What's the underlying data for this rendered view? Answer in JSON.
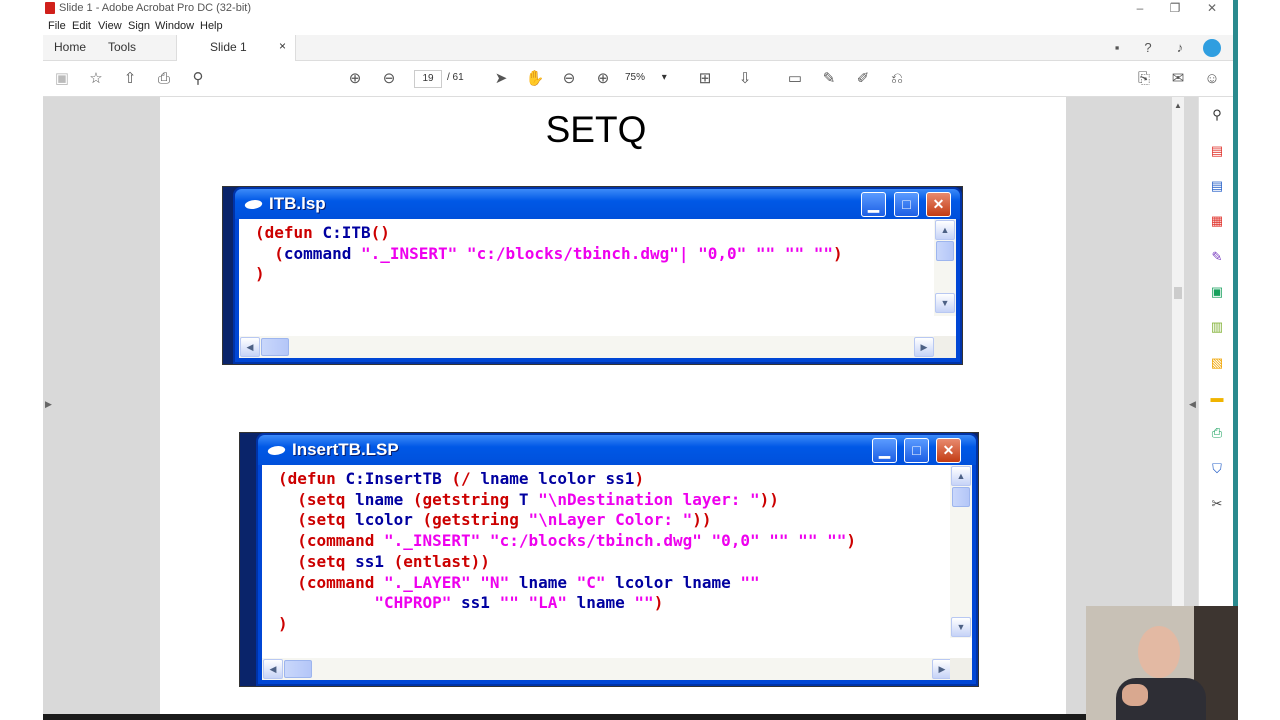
{
  "window": {
    "title": "Slide 1 - Adobe Acrobat Pro DC (32-bit)"
  },
  "menu": [
    "File",
    "Edit",
    "View",
    "Sign",
    "Window",
    "Help"
  ],
  "tabs": {
    "home": "Home",
    "tools": "Tools",
    "document": "Slide 1",
    "close": "×"
  },
  "toolbar": {
    "page_current": "19",
    "page_total": "/ 61",
    "zoom": "75%"
  },
  "slide": {
    "title": "SETQ",
    "window1": {
      "title": "ITB.lsp",
      "code": [
        [
          [
            "p",
            "(defun "
          ],
          [
            "c",
            "C:ITB"
          ],
          [
            "p",
            "()"
          ]
        ],
        [
          [
            "p",
            "  ("
          ],
          [
            "c",
            "command "
          ],
          [
            "s",
            "\"._INSERT\" \"c:/blocks/tbinch.dwg\"| \"0,0\" \"\" \"\" \"\""
          ],
          [
            "p",
            ")"
          ]
        ],
        [
          [
            "p",
            ")"
          ]
        ]
      ]
    },
    "window2": {
      "title": "InsertTB.LSP",
      "code": [
        [
          [
            "p",
            "(defun "
          ],
          [
            "c",
            "C:InsertTB "
          ],
          [
            "p",
            "(/ "
          ],
          [
            "c",
            "lname lcolor ss1"
          ],
          [
            "p",
            ")"
          ]
        ],
        [
          [
            "p",
            "  (setq "
          ],
          [
            "c",
            "lname "
          ],
          [
            "p",
            "(getstring "
          ],
          [
            "c",
            "T "
          ],
          [
            "s",
            "\"\\nDestination layer: \""
          ],
          [
            "p",
            "))"
          ]
        ],
        [
          [
            "p",
            "  (setq "
          ],
          [
            "c",
            "lcolor "
          ],
          [
            "p",
            "(getstring "
          ],
          [
            "s",
            "\"\\nLayer Color: \""
          ],
          [
            "p",
            "))"
          ]
        ],
        [
          [
            "p",
            "  (command "
          ],
          [
            "s",
            "\"._INSERT\" \"c:/blocks/tbinch.dwg\" \"0,0\" \"\" \"\" \"\""
          ],
          [
            "p",
            ")"
          ]
        ],
        [
          [
            "p",
            "  (setq "
          ],
          [
            "c",
            "ss1 "
          ],
          [
            "p",
            "(entlast))"
          ]
        ],
        [
          [
            "p",
            "  (command "
          ],
          [
            "s",
            "\"._LAYER\" \"N\" "
          ],
          [
            "c",
            "lname "
          ],
          [
            "s",
            "\"C\" "
          ],
          [
            "c",
            "lcolor lname "
          ],
          [
            "s",
            "\"\""
          ]
        ],
        [
          [
            "s",
            "          \"CHPROP\" "
          ],
          [
            "c",
            "ss1 "
          ],
          [
            "s",
            "\"\" \"LA\" "
          ],
          [
            "c",
            "lname "
          ],
          [
            "s",
            "\"\""
          ],
          [
            "p",
            ")"
          ]
        ],
        [
          [
            "p",
            ")"
          ]
        ]
      ]
    }
  },
  "icons": {
    "top_right": [
      "comment-icon",
      "help-icon",
      "bell-icon",
      "account-icon"
    ],
    "toolbar": [
      "save-icon",
      "bookmark-star-icon",
      "upload-icon",
      "print-icon",
      "zoom-out-search-icon",
      "prev-page-icon",
      "next-page-icon",
      "select-cursor-icon",
      "hand-icon",
      "zoom-out-icon",
      "zoom-in-icon",
      "fit-page-icon",
      "scroll-mode-icon",
      "comment-tool-icon",
      "pen-icon",
      "highlight-icon",
      "stamp-icon",
      "share-link-icon",
      "email-icon",
      "add-person-icon"
    ],
    "side_panel": [
      "search-zoom-icon",
      "create-pdf-icon",
      "export-pdf-icon",
      "organize-pages-icon",
      "fill-sign-icon",
      "edit-pdf-icon",
      "compress-icon",
      "scan-icon",
      "comment-tool-icon",
      "print-production-icon",
      "protect-icon",
      "more-tools-icon"
    ]
  },
  "colors": {
    "code_keyword": "#0000a0",
    "code_paren": "#cc0000",
    "code_string": "#ee00ee",
    "xp_title": "#0058e6"
  }
}
